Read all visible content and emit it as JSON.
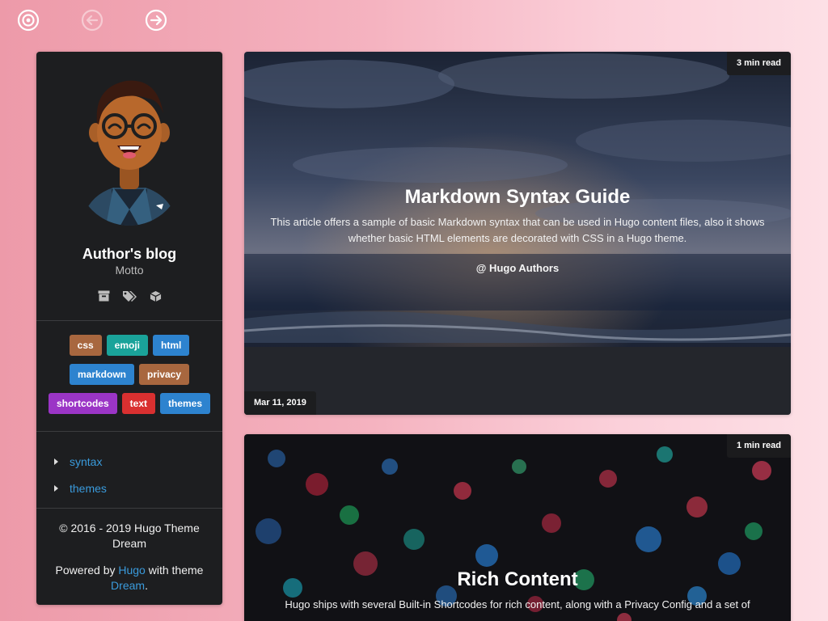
{
  "nav": {
    "icons": [
      "home-icon",
      "back-arrow-icon",
      "forward-arrow-icon"
    ]
  },
  "sidebar": {
    "title": "Author's blog",
    "motto": "Motto",
    "icons": [
      "archive-icon",
      "tags-icon",
      "cube-icon"
    ],
    "tags": [
      {
        "label": "css",
        "color": "#a8673f"
      },
      {
        "label": "emoji",
        "color": "#1aa39a"
      },
      {
        "label": "html",
        "color": "#2d83cf"
      },
      {
        "label": "markdown",
        "color": "#2d83cf"
      },
      {
        "label": "privacy",
        "color": "#a8673f"
      },
      {
        "label": "shortcodes",
        "color": "#9b35c6"
      },
      {
        "label": "text",
        "color": "#d93030"
      },
      {
        "label": "themes",
        "color": "#2d83cf"
      }
    ],
    "categories": [
      "syntax",
      "themes"
    ],
    "footer": {
      "copyright": "© 2016 - 2019 Hugo Theme Dream",
      "powered_prefix": "Powered by",
      "hugo_link": "Hugo",
      "powered_middle": "with theme",
      "dream_link": "Dream",
      "powered_suffix": "."
    }
  },
  "posts": [
    {
      "read_time": "3 min read",
      "title": "Markdown Syntax Guide",
      "summary": "This article offers a sample of basic Markdown syntax that can be used in Hugo content files, also it shows whether basic HTML elements are decorated with CSS in a Hugo theme.",
      "author": "@ Hugo Authors",
      "date": "Mar 11, 2019"
    },
    {
      "read_time": "1 min read",
      "title": "Rich Content",
      "summary": "Hugo ships with several Built-in Shortcodes for rich content, along with a Privacy Config and a set of"
    }
  ],
  "colors": {
    "link": "#3a9bdc",
    "sidebar_bg": "#1d1e20"
  }
}
